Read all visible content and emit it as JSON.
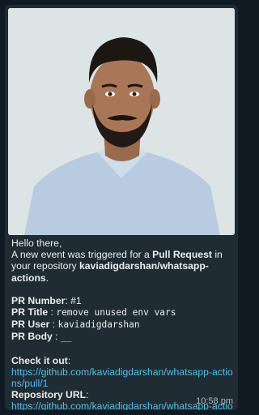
{
  "message": {
    "greeting": "Hello there,",
    "intro_before": "A new event was triggered for a ",
    "event_type": "Pull Request",
    "intro_mid": " in your repository ",
    "repository": "kaviadigdarshan/whatsapp-actions",
    "intro_end": ".",
    "pr_number_label": "PR Number",
    "pr_number_value": ": #1",
    "pr_title_label": "PR Title",
    "pr_title_sep": " : ",
    "pr_title_value": "remove unused env vars",
    "pr_user_label": "PR User",
    "pr_user_sep": " : ",
    "pr_user_value": "kaviadigdarshan",
    "pr_body_label": "PR Body",
    "pr_body_sep": "  : ",
    "pr_body_value": "__",
    "check_label": "Check it out",
    "check_colon": ":",
    "pr_url": "https://github.com/kaviadigdarshan/whatsapp-actions/pull/1",
    "repo_url_label": "Repository URL",
    "repo_url_colon": ":",
    "repo_url": "https://github.com/kaviadigdarshan/whatsapp-actions",
    "timestamp": "10:58 pm"
  }
}
